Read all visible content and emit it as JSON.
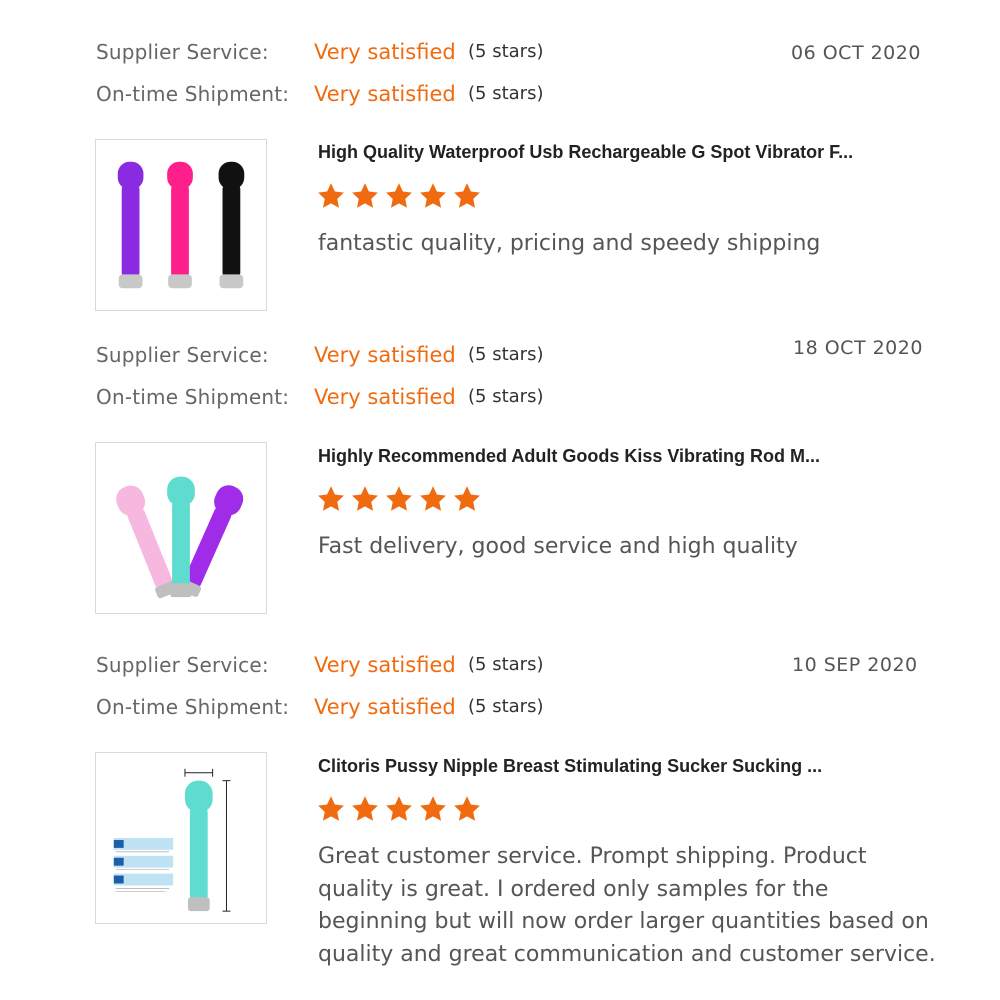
{
  "colors": {
    "accent": "#f06a0f",
    "star": "#f06a0f",
    "text": "#333333",
    "muted": "#666666"
  },
  "labels": {
    "supplier_service": "Supplier Service:",
    "on_time_shipment": "On-time Shipment:"
  },
  "reviews": [
    {
      "date": "06 OCT 2020",
      "supplier_service": {
        "value": "Very satisfied",
        "stars_text": "(5 stars)"
      },
      "on_time_shipment": {
        "value": "Very satisfied",
        "stars_text": "(5 stars)"
      },
      "product_image_icon": "wand-massagers-purple-pink-black",
      "product_title": "High Quality Waterproof Usb Rechargeable G Spot Vibrator F...",
      "rating": 5,
      "comment": "fantastic quality, pricing and speedy shipping"
    },
    {
      "date": "18 OCT 2020",
      "supplier_service": {
        "value": "Very satisfied",
        "stars_text": "(5 stars)"
      },
      "on_time_shipment": {
        "value": "Very satisfied",
        "stars_text": "(5 stars)"
      },
      "product_image_icon": "wand-massagers-pink-teal-purple",
      "product_title": "Highly Recommended Adult Goods Kiss Vibrating Rod M...",
      "rating": 5,
      "comment": "Fast delivery, good service and high quality"
    },
    {
      "date": "10 SEP 2020",
      "supplier_service": {
        "value": "Very satisfied",
        "stars_text": "(5 stars)"
      },
      "on_time_shipment": {
        "value": "Very satisfied",
        "stars_text": "(5 stars)"
      },
      "product_image_icon": "wand-massager-teal-dimensions",
      "product_title": "Clitoris Pussy Nipple Breast Stimulating Sucker Sucking ...",
      "rating": 5,
      "comment": "Great customer service. Prompt shipping. Product quality is great. I ordered only samples for the beginning but will now order larger quantities based on quality and great communication and customer service."
    }
  ]
}
